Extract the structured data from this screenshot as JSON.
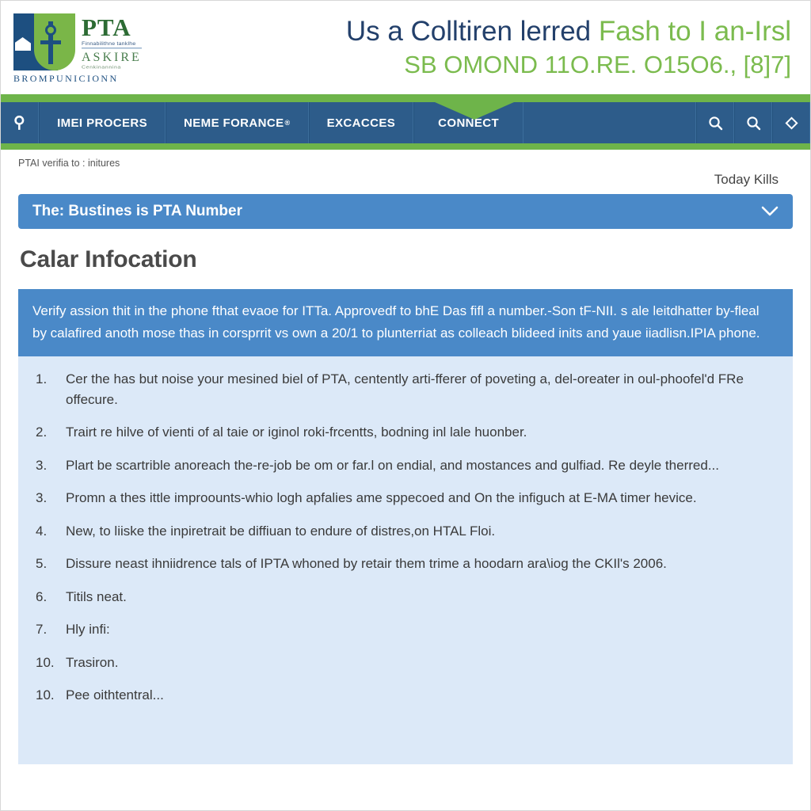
{
  "masthead": {
    "logo": {
      "mark_name": "pta-shield-logo",
      "primary": "PTA",
      "sub_primary": "Finnabilithne tanklhe",
      "secondary": "ASKIRE",
      "sub_secondary": "Cenkinannina",
      "footer_word": "BROMPUNICIONN"
    },
    "banner": {
      "line1_dark": "Us a Colltiren lerred",
      "line1_green": "Fash to I an-Irsl",
      "line2": "SB OMOND 11O.RE. O15O6., [8]7]"
    }
  },
  "nav": {
    "home_icon": "tree-icon",
    "items": [
      {
        "label": "IMEI PROCERS",
        "sup": ""
      },
      {
        "label": "NEME FORANCE",
        "sup": "®"
      },
      {
        "label": "EXCACCES",
        "sup": ""
      },
      {
        "label": "CONNECT",
        "sup": ""
      }
    ],
    "icons": [
      {
        "name": "search-icon"
      },
      {
        "name": "search-icon"
      },
      {
        "name": "diamond-icon"
      }
    ]
  },
  "breadcrumb": {
    "text": "PTAI verifia to : initures",
    "right_label": "Today Kills"
  },
  "accordion": {
    "title": "The: Bustines is PTA Number",
    "chevron_icon": "chevron-down-icon"
  },
  "page": {
    "heading": "Calar Infocation",
    "callout": "Verify assion thit in the phone fthat evaoe for ITTa. Approvedf to bhE Das fifl a number.-Son tF-NII. s ale leitdhatter by-fleal by calafired anoth mose thas in corsprrit vs own a 20/1 to plunterriat as colleach blideed inits and yaue iiadlisn.IPIA phone."
  },
  "steps": [
    {
      "num": "1.",
      "text": "Cer the has but noise your mesined biel of PTA, centently arti-fferer of poveting a, del-oreater in oul-phoofel'd FRe offecure."
    },
    {
      "num": "2.",
      "text": "Trairt re hilve of vienti of al taie or iginol roki-frcentts, bodning inl lale huonber."
    },
    {
      "num": "3.",
      "text": "Plart be scartrible anoreach the-re-job be om or far.l on endial, and mostances and gulfiad. Re deyle therred..."
    },
    {
      "num": "3.",
      "text": "Promn a thes ittle improounts-whio logh apfalies ame sppecoed and On the infiguch at E-MA timer hevice."
    },
    {
      "num": "4.",
      "text": "New, to liiske the inpiretrait be diffiuan to endure of distres,on HTAL Floi."
    },
    {
      "num": "5.",
      "text": "Dissure neast ihniidrence tals of IPTA whoned by retair them trime a hoodarn ara\\iog the CKIl's 2006."
    },
    {
      "num": "6.",
      "text": "Titils neat."
    },
    {
      "num": "7.",
      "text": "Hly infi:"
    },
    {
      "num": "10.",
      "text": "Trasiron."
    },
    {
      "num": "10.",
      "text": "Pee oithtentral..."
    }
  ],
  "colors": {
    "nav_blue": "#2d5c8a",
    "accent_green": "#6eb44a",
    "panel_blue": "#dce9f8",
    "callout_blue": "#4a89c8",
    "logo_green": "#7ab648",
    "logo_navy": "#1d4f80"
  }
}
